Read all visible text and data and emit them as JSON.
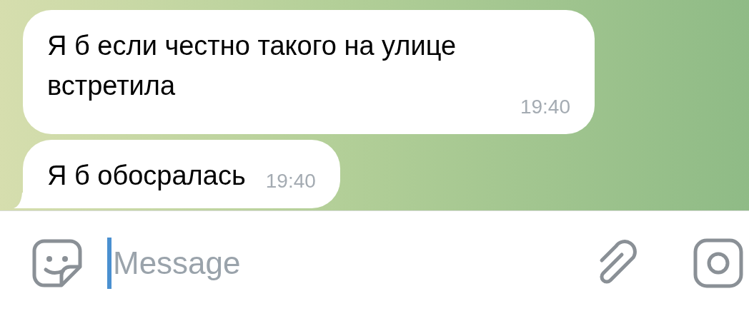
{
  "messages": [
    {
      "text": "Я б если честно такого на улице встретила",
      "time": "19:40",
      "tail": false
    },
    {
      "text": "Я б обосралась",
      "time": "19:40",
      "tail": true
    }
  ],
  "composer": {
    "placeholder": "Message"
  }
}
